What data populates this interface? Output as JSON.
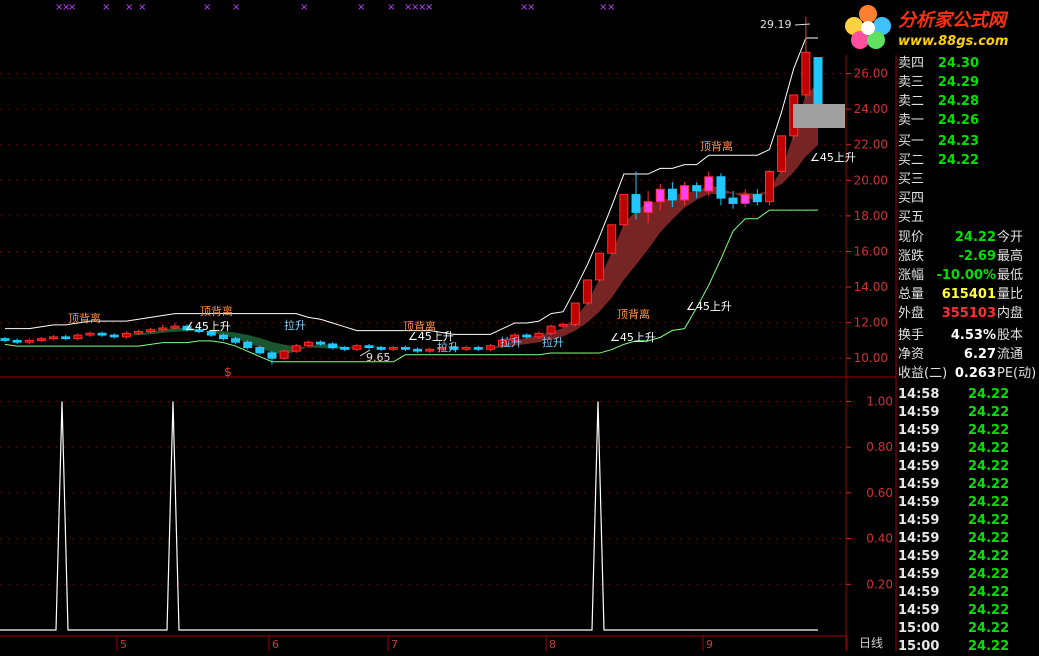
{
  "logo": {
    "title": "分析家公式网",
    "url": "www.88gs.com"
  },
  "orderbook": {
    "asks": [
      {
        "label": "卖四",
        "price": "24.30"
      },
      {
        "label": "卖三",
        "price": "24.29"
      },
      {
        "label": "卖二",
        "price": "24.28"
      },
      {
        "label": "卖一",
        "price": "24.26"
      }
    ],
    "bids": [
      {
        "label": "买一",
        "price": "24.23"
      },
      {
        "label": "买二",
        "price": "24.22"
      },
      {
        "label": "买三",
        "price": ""
      },
      {
        "label": "买四",
        "price": ""
      },
      {
        "label": "买五",
        "price": ""
      }
    ]
  },
  "quote": [
    {
      "label": "现价",
      "value": "24.22",
      "label2": "今开",
      "color": "green"
    },
    {
      "label": "涨跌",
      "value": "-2.69",
      "label2": "最高",
      "color": "green"
    },
    {
      "label": "涨幅",
      "value": "-10.00%",
      "label2": "最低",
      "color": "green"
    },
    {
      "label": "总量",
      "value": "615401",
      "label2": "量比",
      "color": "yellow"
    },
    {
      "label": "外盘",
      "value": "355103",
      "label2": "内盘",
      "color": "red"
    }
  ],
  "stats": [
    {
      "label": "换手",
      "value": "4.53%",
      "label2": "股本",
      "color": "white"
    },
    {
      "label": "净资",
      "value": "6.27",
      "label2": "流通",
      "color": "white"
    },
    {
      "label": "收益(二)",
      "value": "0.263",
      "label2": "PE(动)",
      "color": "white"
    }
  ],
  "ticks": [
    {
      "time": "14:58",
      "price": "24.22"
    },
    {
      "time": "14:59",
      "price": "24.22"
    },
    {
      "time": "14:59",
      "price": "24.22"
    },
    {
      "time": "14:59",
      "price": "24.22"
    },
    {
      "time": "14:59",
      "price": "24.22"
    },
    {
      "time": "14:59",
      "price": "24.22"
    },
    {
      "time": "14:59",
      "price": "24.22"
    },
    {
      "time": "14:59",
      "price": "24.22"
    },
    {
      "time": "14:59",
      "price": "24.22"
    },
    {
      "time": "14:59",
      "price": "24.22"
    },
    {
      "time": "14:59",
      "price": "24.22"
    },
    {
      "time": "14:59",
      "price": "24.22"
    },
    {
      "time": "14:59",
      "price": "24.22"
    },
    {
      "time": "15:00",
      "price": "24.22"
    },
    {
      "time": "15:00",
      "price": "24.22"
    }
  ],
  "price_axis": [
    "26.00",
    "24.00",
    "22.00",
    "20.00",
    "18.00",
    "16.00",
    "14.00",
    "12.00",
    "10.00"
  ],
  "indicator_axis": [
    "1.00",
    "0.80",
    "0.60",
    "0.40",
    "0.20"
  ],
  "x_axis": [
    "5",
    "6",
    "7",
    "8",
    "9"
  ],
  "period_label": "日线",
  "annotations": {
    "high": "29.19",
    "low": "9.65",
    "top_divergence": "顶背离",
    "rise45": "45上升",
    "limit_up": "拉升",
    "dollar": "$"
  },
  "chart_data": {
    "type": "line",
    "price_candles": [
      {
        "o": 11.1,
        "c": 11.0,
        "h": 11.2,
        "l": 10.9
      },
      {
        "o": 11.0,
        "c": 10.9,
        "h": 11.1,
        "l": 10.8
      },
      {
        "o": 10.9,
        "c": 11.0,
        "h": 11.1,
        "l": 10.8
      },
      {
        "o": 11.0,
        "c": 11.1,
        "h": 11.2,
        "l": 10.9
      },
      {
        "o": 11.1,
        "c": 11.2,
        "h": 11.3,
        "l": 11.0
      },
      {
        "o": 11.2,
        "c": 11.1,
        "h": 11.3,
        "l": 11.0
      },
      {
        "o": 11.1,
        "c": 11.3,
        "h": 11.4,
        "l": 11.0
      },
      {
        "o": 11.3,
        "c": 11.4,
        "h": 11.5,
        "l": 11.2
      },
      {
        "o": 11.4,
        "c": 11.3,
        "h": 11.5,
        "l": 11.2
      },
      {
        "o": 11.3,
        "c": 11.2,
        "h": 11.4,
        "l": 11.1
      },
      {
        "o": 11.2,
        "c": 11.4,
        "h": 11.5,
        "l": 11.1
      },
      {
        "o": 11.4,
        "c": 11.5,
        "h": 11.6,
        "l": 11.3
      },
      {
        "o": 11.5,
        "c": 11.6,
        "h": 11.7,
        "l": 11.4
      },
      {
        "o": 11.6,
        "c": 11.7,
        "h": 11.9,
        "l": 11.5
      },
      {
        "o": 11.7,
        "c": 11.8,
        "h": 12.0,
        "l": 11.6
      },
      {
        "o": 11.8,
        "c": 11.6,
        "h": 11.9,
        "l": 11.5
      },
      {
        "o": 11.6,
        "c": 11.5,
        "h": 11.7,
        "l": 11.4
      },
      {
        "o": 11.5,
        "c": 11.3,
        "h": 11.6,
        "l": 11.2
      },
      {
        "o": 11.3,
        "c": 11.1,
        "h": 11.4,
        "l": 11.0
      },
      {
        "o": 11.1,
        "c": 10.9,
        "h": 11.2,
        "l": 10.8
      },
      {
        "o": 10.9,
        "c": 10.6,
        "h": 11.0,
        "l": 10.5
      },
      {
        "o": 10.6,
        "c": 10.3,
        "h": 10.7,
        "l": 10.2
      },
      {
        "o": 10.3,
        "c": 10.0,
        "h": 10.4,
        "l": 9.65
      },
      {
        "o": 10.0,
        "c": 10.4,
        "h": 10.5,
        "l": 9.9
      },
      {
        "o": 10.4,
        "c": 10.7,
        "h": 10.8,
        "l": 10.3
      },
      {
        "o": 10.7,
        "c": 10.9,
        "h": 11.0,
        "l": 10.6
      },
      {
        "o": 10.9,
        "c": 10.8,
        "h": 11.0,
        "l": 10.7
      },
      {
        "o": 10.8,
        "c": 10.6,
        "h": 10.9,
        "l": 10.5
      },
      {
        "o": 10.6,
        "c": 10.5,
        "h": 10.7,
        "l": 10.4
      },
      {
        "o": 10.5,
        "c": 10.7,
        "h": 10.8,
        "l": 10.4
      },
      {
        "o": 10.7,
        "c": 10.6,
        "h": 10.8,
        "l": 10.5
      },
      {
        "o": 10.6,
        "c": 10.5,
        "h": 10.7,
        "l": 10.4
      },
      {
        "o": 10.5,
        "c": 10.6,
        "h": 10.7,
        "l": 10.4
      },
      {
        "o": 10.6,
        "c": 10.5,
        "h": 10.7,
        "l": 10.4
      },
      {
        "o": 10.5,
        "c": 10.4,
        "h": 10.6,
        "l": 10.3
      },
      {
        "o": 10.4,
        "c": 10.5,
        "h": 10.6,
        "l": 10.3
      },
      {
        "o": 10.5,
        "c": 10.6,
        "h": 10.7,
        "l": 10.4
      },
      {
        "o": 10.6,
        "c": 10.5,
        "h": 10.7,
        "l": 10.4
      },
      {
        "o": 10.5,
        "c": 10.6,
        "h": 10.7,
        "l": 10.4
      },
      {
        "o": 10.6,
        "c": 10.5,
        "h": 10.7,
        "l": 10.4
      },
      {
        "o": 10.5,
        "c": 10.7,
        "h": 10.8,
        "l": 10.4
      },
      {
        "o": 10.7,
        "c": 11.0,
        "h": 11.1,
        "l": 10.6
      },
      {
        "o": 11.0,
        "c": 11.3,
        "h": 11.4,
        "l": 10.9
      },
      {
        "o": 11.3,
        "c": 11.2,
        "h": 11.4,
        "l": 11.1
      },
      {
        "o": 11.2,
        "c": 11.4,
        "h": 11.5,
        "l": 11.1
      },
      {
        "o": 11.4,
        "c": 11.8,
        "h": 11.9,
        "l": 11.3
      },
      {
        "o": 11.8,
        "c": 11.9,
        "h": 12.0,
        "l": 11.7
      },
      {
        "o": 11.9,
        "c": 13.1,
        "h": 13.1,
        "l": 11.8
      },
      {
        "o": 13.1,
        "c": 14.4,
        "h": 14.4,
        "l": 13.0
      },
      {
        "o": 14.4,
        "c": 15.9,
        "h": 15.9,
        "l": 14.3
      },
      {
        "o": 15.9,
        "c": 17.5,
        "h": 17.5,
        "l": 15.8
      },
      {
        "o": 17.5,
        "c": 19.2,
        "h": 19.2,
        "l": 17.4
      },
      {
        "o": 19.2,
        "c": 18.2,
        "h": 20.5,
        "l": 17.8
      },
      {
        "o": 18.2,
        "c": 18.8,
        "h": 19.4,
        "l": 17.6
      },
      {
        "o": 18.8,
        "c": 19.5,
        "h": 19.8,
        "l": 18.3
      },
      {
        "o": 19.5,
        "c": 18.9,
        "h": 19.9,
        "l": 18.5
      },
      {
        "o": 18.9,
        "c": 19.7,
        "h": 19.9,
        "l": 18.6
      },
      {
        "o": 19.7,
        "c": 19.4,
        "h": 19.9,
        "l": 19.0
      },
      {
        "o": 19.4,
        "c": 20.2,
        "h": 20.5,
        "l": 19.1
      },
      {
        "o": 20.2,
        "c": 19.0,
        "h": 20.4,
        "l": 18.6
      },
      {
        "o": 19.0,
        "c": 18.7,
        "h": 19.4,
        "l": 18.4
      },
      {
        "o": 18.7,
        "c": 19.2,
        "h": 19.5,
        "l": 18.5
      },
      {
        "o": 19.2,
        "c": 18.8,
        "h": 19.5,
        "l": 18.6
      },
      {
        "o": 18.8,
        "c": 20.5,
        "h": 20.6,
        "l": 18.6
      },
      {
        "o": 20.5,
        "c": 22.5,
        "h": 22.5,
        "l": 20.4
      },
      {
        "o": 22.5,
        "c": 24.8,
        "h": 24.8,
        "l": 22.3
      },
      {
        "o": 24.8,
        "c": 27.2,
        "h": 29.19,
        "l": 24.6
      },
      {
        "o": 26.9,
        "c": 24.22,
        "h": 26.9,
        "l": 24.22
      }
    ],
    "indicator_spikes": [
      0.0,
      1.0,
      0.0,
      1.0,
      0.0,
      1.0,
      0.0
    ],
    "ylim_price": [
      9.0,
      28.0
    ],
    "ylim_indicator": [
      0,
      1.05
    ]
  }
}
